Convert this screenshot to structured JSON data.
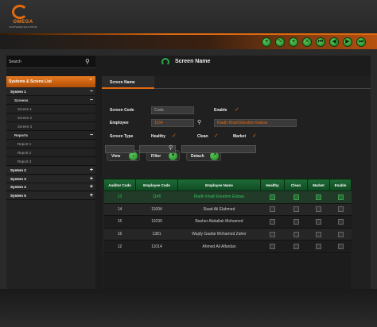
{
  "app": {
    "brand": "OMEGA",
    "brand_sub": "SOFTWARE SOLUTIONS"
  },
  "toolbar": {
    "buttons": [
      "+",
      "✎",
      "+",
      "✕",
      "⏮",
      "◀",
      "▶",
      "⏭"
    ]
  },
  "search": {
    "label": "Search"
  },
  "screen": {
    "title": "Screen Name"
  },
  "sidebar": {
    "title": "Systems & Screns List",
    "items": [
      {
        "label": "System 1",
        "level": 1,
        "ctl": "−"
      },
      {
        "label": "Screens",
        "level": 2,
        "ctl": "−"
      },
      {
        "label": "Screen 1",
        "level": 3,
        "ctl": ""
      },
      {
        "label": "Screen 2",
        "level": 3,
        "ctl": ""
      },
      {
        "label": "Screen 3",
        "level": 3,
        "ctl": ""
      },
      {
        "label": "Reports",
        "level": 2,
        "ctl": "−"
      },
      {
        "label": "Report 1",
        "level": 3,
        "ctl": ""
      },
      {
        "label": "Report 2",
        "level": 3,
        "ctl": ""
      },
      {
        "label": "Report 3",
        "level": 3,
        "ctl": ""
      },
      {
        "label": "System 2",
        "level": 1,
        "ctl": "+"
      },
      {
        "label": "System 3",
        "level": 1,
        "ctl": "+"
      },
      {
        "label": "System 4",
        "level": 1,
        "ctl": "+"
      },
      {
        "label": "System 5",
        "level": 1,
        "ctl": "+"
      }
    ]
  },
  "tab": {
    "label": "Screen Name"
  },
  "form": {
    "screen_code_label": "Screen Code",
    "screen_code_placeholder": "Code",
    "enable_label": "Enable",
    "employee_label": "Employee",
    "employee_code": "1154",
    "employee_name": "Riadh Khalil Ebrahim Elabas",
    "screen_type_label": "Screen Type",
    "healthy_label": "Healthy",
    "clean_label": "Clean",
    "market_label": "Market",
    "check_glyph": "✓"
  },
  "actions": {
    "view": "View",
    "filter": "Filter",
    "detach": "Detach"
  },
  "grid": {
    "columns": [
      "Auditor Code",
      "Employee Code",
      "Employee Name",
      "Healthy",
      "Clean",
      "Market",
      "Enable"
    ],
    "rows": [
      {
        "auditor": "13",
        "emp_code": "1145",
        "name": "Riadh Khalil Ebrahim Elabas",
        "healthy": true,
        "clean": true,
        "market": true,
        "enable": true
      },
      {
        "auditor": "14",
        "emp_code": "11004",
        "name": "Raad Ali Elahmed",
        "healthy": false,
        "clean": false,
        "market": false,
        "enable": false
      },
      {
        "auditor": "15",
        "emp_code": "11039",
        "name": "Basher Abdallah Mohamed",
        "healthy": false,
        "clean": false,
        "market": false,
        "enable": false
      },
      {
        "auditor": "16",
        "emp_code": "1381",
        "name": "Wajdy Gaafar Mohamed Zaher",
        "healthy": false,
        "clean": false,
        "market": false,
        "enable": false
      },
      {
        "auditor": "12",
        "emp_code": "11014",
        "name": "Ahmed Ali Alfardan",
        "healthy": false,
        "clean": false,
        "market": false,
        "enable": false
      }
    ]
  },
  "colors": {
    "accent": "#e06a10",
    "green": "#2aa84a",
    "panel": "#1c1c1c"
  }
}
